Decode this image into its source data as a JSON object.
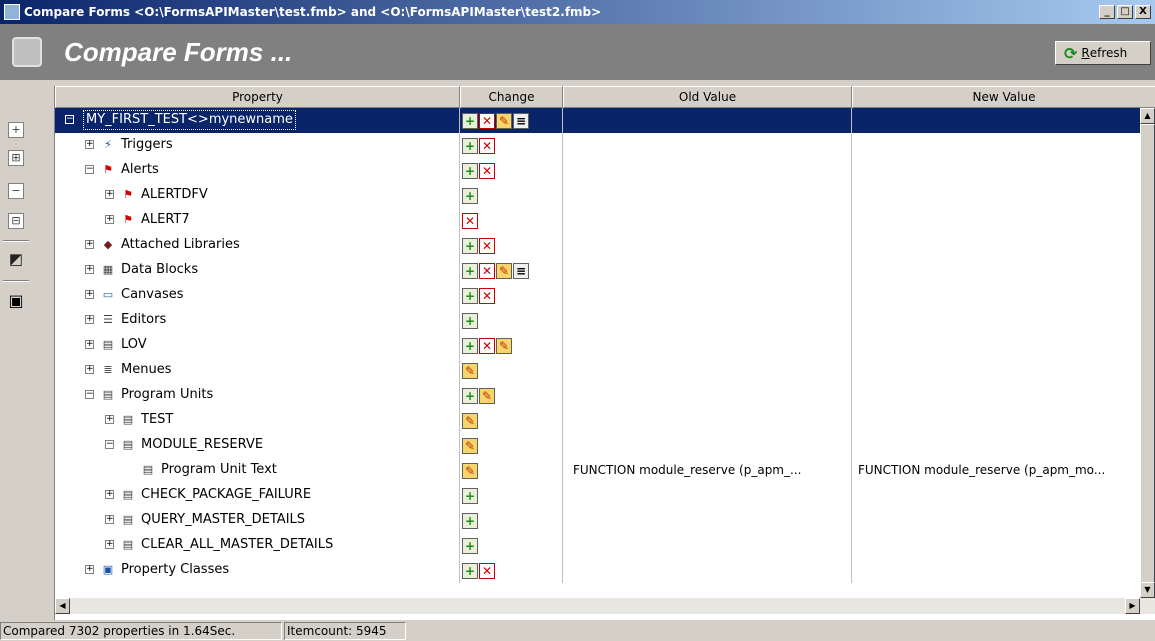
{
  "window": {
    "title": "Compare Forms <O:\\FormsAPIMaster\\test.fmb> and <O:\\FormsAPIMaster\\test2.fmb>",
    "minimize": "_",
    "maximize": "□",
    "close": "X"
  },
  "header": {
    "title": "Compare Forms ...",
    "refresh_accel": "R",
    "refresh_rest": "efresh"
  },
  "toolbar": {
    "icons": [
      "expand-icon",
      "expand-all-icon",
      "collapse-icon",
      "collapse-all-icon",
      "palette-icon",
      "save-icon"
    ]
  },
  "columns": [
    "Property",
    "Change",
    "Old Value",
    "New Value"
  ],
  "rows": [
    {
      "indent": 0,
      "exp": "−",
      "icon": "",
      "label": "MY_FIRST_TEST<>mynewname",
      "changes": [
        "add",
        "del",
        "mod",
        "chg"
      ],
      "old": "",
      "new": "",
      "selected": true
    },
    {
      "indent": 1,
      "exp": "+",
      "icon": "triggers-icon",
      "label": "Triggers",
      "changes": [
        "add",
        "del"
      ],
      "old": "",
      "new": ""
    },
    {
      "indent": 1,
      "exp": "−",
      "icon": "flag-icon",
      "label": "Alerts",
      "changes": [
        "add",
        "del"
      ],
      "old": "",
      "new": ""
    },
    {
      "indent": 2,
      "exp": "+",
      "icon": "flag-icon",
      "label": "ALERTDFV",
      "changes": [
        "add"
      ],
      "old": "",
      "new": ""
    },
    {
      "indent": 2,
      "exp": "+",
      "icon": "flag-icon",
      "label": "ALERT7",
      "changes": [
        "del"
      ],
      "old": "",
      "new": ""
    },
    {
      "indent": 1,
      "exp": "+",
      "icon": "library-icon",
      "label": "Attached Libraries",
      "changes": [
        "add",
        "del"
      ],
      "old": "",
      "new": ""
    },
    {
      "indent": 1,
      "exp": "+",
      "icon": "data-block-icon",
      "label": "Data Blocks",
      "changes": [
        "add",
        "del",
        "mod",
        "chg"
      ],
      "old": "",
      "new": ""
    },
    {
      "indent": 1,
      "exp": "+",
      "icon": "canvas-icon",
      "label": "Canvases",
      "changes": [
        "add",
        "del"
      ],
      "old": "",
      "new": ""
    },
    {
      "indent": 1,
      "exp": "+",
      "icon": "editor-icon",
      "label": "Editors",
      "changes": [
        "add"
      ],
      "old": "",
      "new": ""
    },
    {
      "indent": 1,
      "exp": "+",
      "icon": "lov-icon",
      "label": "LOV",
      "changes": [
        "add",
        "del",
        "mod"
      ],
      "old": "",
      "new": ""
    },
    {
      "indent": 1,
      "exp": "+",
      "icon": "menu-icon",
      "label": "Menues",
      "changes": [
        "mod"
      ],
      "old": "",
      "new": ""
    },
    {
      "indent": 1,
      "exp": "−",
      "icon": "program-unit-icon",
      "label": "Program Units",
      "changes": [
        "add",
        "mod"
      ],
      "old": "",
      "new": ""
    },
    {
      "indent": 2,
      "exp": "+",
      "icon": "program-unit-icon",
      "label": "TEST",
      "changes": [
        "mod"
      ],
      "old": "",
      "new": ""
    },
    {
      "indent": 2,
      "exp": "−",
      "icon": "program-unit-icon",
      "label": "MODULE_RESERVE",
      "changes": [
        "mod"
      ],
      "old": "",
      "new": ""
    },
    {
      "indent": 3,
      "exp": "",
      "icon": "program-unit-icon",
      "label": "Program Unit Text",
      "changes": [
        "mod"
      ],
      "old": "FUNCTION module_reserve (p_apm_...",
      "new": "FUNCTION module_reserve (p_apm_mo..."
    },
    {
      "indent": 2,
      "exp": "+",
      "icon": "program-unit-icon",
      "label": "CHECK_PACKAGE_FAILURE",
      "changes": [
        "add"
      ],
      "old": "",
      "new": ""
    },
    {
      "indent": 2,
      "exp": "+",
      "icon": "program-unit-icon",
      "label": "QUERY_MASTER_DETAILS",
      "changes": [
        "add"
      ],
      "old": "",
      "new": ""
    },
    {
      "indent": 2,
      "exp": "+",
      "icon": "program-unit-icon",
      "label": "CLEAR_ALL_MASTER_DETAILS",
      "changes": [
        "add"
      ],
      "old": "",
      "new": ""
    },
    {
      "indent": 1,
      "exp": "+",
      "icon": "property-class-icon",
      "label": "Property Classes",
      "changes": [
        "add",
        "del"
      ],
      "old": "",
      "new": ""
    }
  ],
  "change_glyphs": {
    "add": "+",
    "del": "✕",
    "mod": "✎",
    "chg": "≡"
  },
  "icon_glyphs": {
    "triggers-icon": "⚡",
    "flag-icon": "⚑",
    "library-icon": "◆",
    "data-block-icon": "▦",
    "canvas-icon": "▭",
    "editor-icon": "☰",
    "lov-icon": "▤",
    "menu-icon": "≣",
    "program-unit-icon": "▤",
    "property-class-icon": "▣"
  },
  "icon_colors": {
    "triggers-icon": "#1c4fa8",
    "flag-icon": "#d40000",
    "library-icon": "#7a1a1a",
    "data-block-icon": "#404040",
    "canvas-icon": "#2a6a9a",
    "editor-icon": "#404040",
    "lov-icon": "#404040",
    "menu-icon": "#404040",
    "program-unit-icon": "#404040",
    "property-class-icon": "#1c4fa8"
  },
  "status": {
    "compared": "Compared 7302 properties in 1.64Sec.",
    "itemcount": "Itemcount: 5945"
  }
}
